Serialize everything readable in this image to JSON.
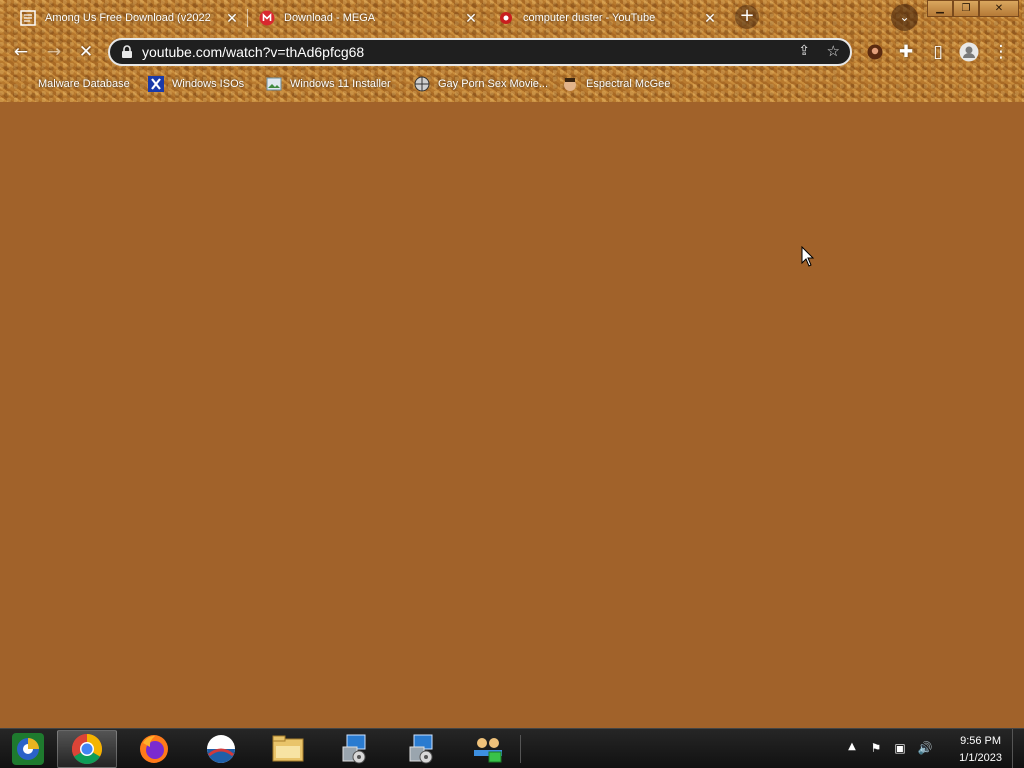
{
  "browser": {
    "tabs": [
      {
        "title": "Among Us Free Download (v2022",
        "favicon": "page-icon"
      },
      {
        "title": "Download - MEGA",
        "favicon": "mega-icon"
      },
      {
        "title": "computer duster - YouTube",
        "favicon": "youtube-icon"
      }
    ],
    "url": "youtube.com/watch?v=thAd6pfcg68"
  },
  "bookmarks": [
    {
      "label": "Malware Database",
      "icon": "folder-icon"
    },
    {
      "label": "Windows ISOs",
      "icon": "x-icon"
    },
    {
      "label": "Windows 11 Installer",
      "icon": "image-icon"
    },
    {
      "label": "Gay Porn Sex Movie...",
      "icon": "globe-icon"
    },
    {
      "label": "Espectral McGee",
      "icon": "avatar-icon"
    }
  ],
  "taskbar": {
    "apps": [
      "chrome",
      "firefox",
      "outlook",
      "file-explorer",
      "installer",
      "installer",
      "network-app"
    ]
  },
  "clock": {
    "time": "9:56 PM",
    "date": "1/1/2023"
  },
  "colors": {
    "page_bg": "#a1622a",
    "omnibox_bg": "#1f1f1f",
    "taskbar_bg": "#1a1a1a"
  }
}
